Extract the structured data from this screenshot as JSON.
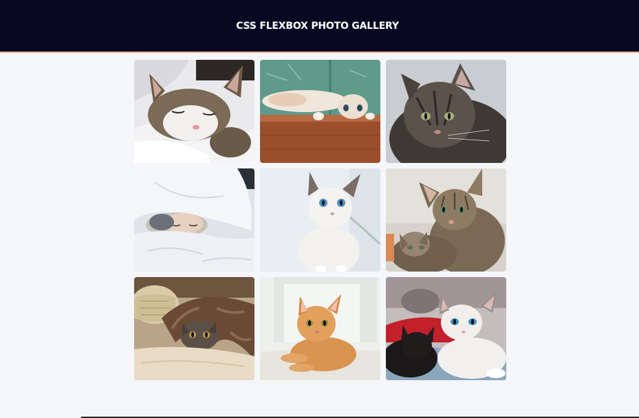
{
  "header": {
    "title": "CSS FLEXBOX PHOTO GALLERY"
  },
  "gallery": {
    "photos": [
      {
        "subject": "sleeping tabby and white kitten on white blanket"
      },
      {
        "subject": "kitten lying upside down on wooden floor"
      },
      {
        "subject": "fluffy grey tabby cat"
      },
      {
        "subject": "kitten hiding under white duvet"
      },
      {
        "subject": "white fluffy kitten with blue eyes"
      },
      {
        "subject": "two tabby kittens"
      },
      {
        "subject": "tabby kitten under brown fluffy blanket"
      },
      {
        "subject": "orange ginger kitten lying down"
      },
      {
        "subject": "black kitten and white kitten with blue eyes"
      }
    ]
  },
  "colors": {
    "header_bg": "#080822",
    "header_border": "#f0b48a",
    "page_bg": "#f4f6f9",
    "title_text": "#ffffff"
  }
}
